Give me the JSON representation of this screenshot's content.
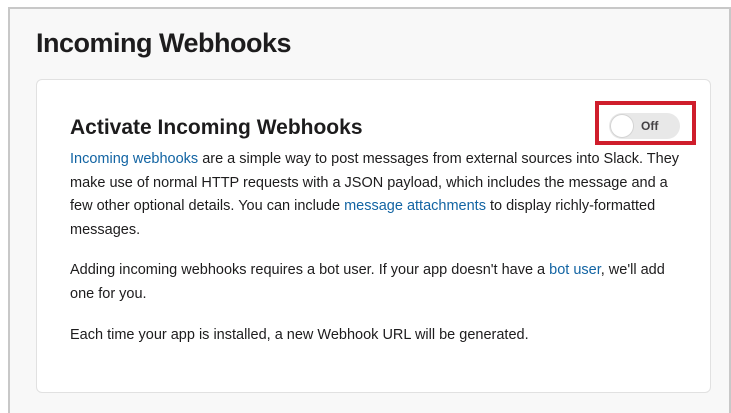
{
  "page": {
    "title": "Incoming Webhooks"
  },
  "card": {
    "title": "Activate Incoming Webhooks",
    "toggle": {
      "label": "Off",
      "state": "off"
    },
    "paragraph1": {
      "link1": "Incoming webhooks",
      "text1": " are a simple way to post messages from external sources into Slack. They make use of normal HTTP requests with a JSON payload, which includes the message and a few other optional details. You can include ",
      "link2": "message attachments",
      "text2": " to display richly-formatted messages."
    },
    "paragraph2": {
      "text1": "Adding incoming webhooks requires a bot user. If your app doesn't have a ",
      "link1": "bot user",
      "text2": ", we'll add one for you."
    },
    "paragraph3": {
      "text1": "Each time your app is installed, a new Webhook URL will be generated."
    }
  },
  "colors": {
    "link": "#1264a3",
    "highlight": "#cf1d2b",
    "text": "#1d1c1d"
  }
}
